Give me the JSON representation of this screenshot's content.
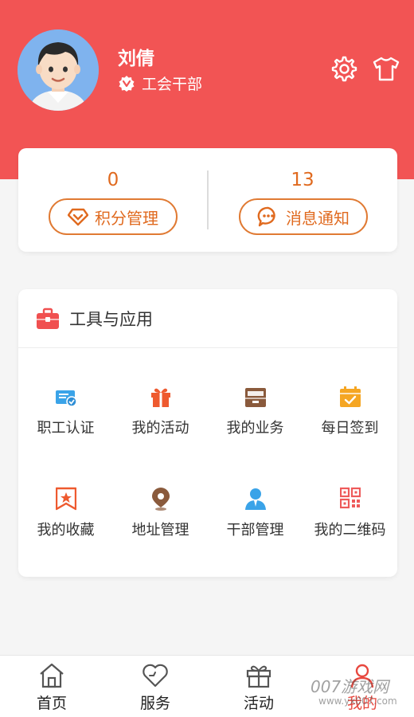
{
  "profile": {
    "name": "刘倩",
    "role": "工会干部",
    "avatar_bg": "#7fb3ee"
  },
  "header": {
    "bg_color": "#f25454",
    "icons": [
      "settings-icon",
      "shirt-icon"
    ]
  },
  "stats": [
    {
      "value": "0",
      "label": "积分管理",
      "icon": "diamond-tag-icon"
    },
    {
      "value": "13",
      "label": "消息通知",
      "icon": "chat-bubble-icon"
    }
  ],
  "tools": {
    "title": "工具与应用",
    "items": [
      {
        "label": "职工认证",
        "icon": "id-card-check-icon"
      },
      {
        "label": "我的活动",
        "icon": "gift-icon"
      },
      {
        "label": "我的业务",
        "icon": "archive-box-icon"
      },
      {
        "label": "每日签到",
        "icon": "calendar-check-icon"
      },
      {
        "label": "我的收藏",
        "icon": "bookmark-star-icon"
      },
      {
        "label": "地址管理",
        "icon": "location-pin-icon"
      },
      {
        "label": "干部管理",
        "icon": "person-icon"
      },
      {
        "label": "我的二维码",
        "icon": "qr-code-icon"
      }
    ]
  },
  "tabbar": {
    "items": [
      {
        "label": "首页",
        "icon": "home-icon"
      },
      {
        "label": "服务",
        "icon": "heart-icon"
      },
      {
        "label": "活动",
        "icon": "gift-box-icon"
      },
      {
        "label": "我的",
        "icon": "user-icon"
      }
    ]
  },
  "watermark": {
    "text": "007游戏网",
    "url": "www.yx007.com"
  },
  "colors": {
    "accent": "#e06a1f",
    "header": "#f25454"
  }
}
